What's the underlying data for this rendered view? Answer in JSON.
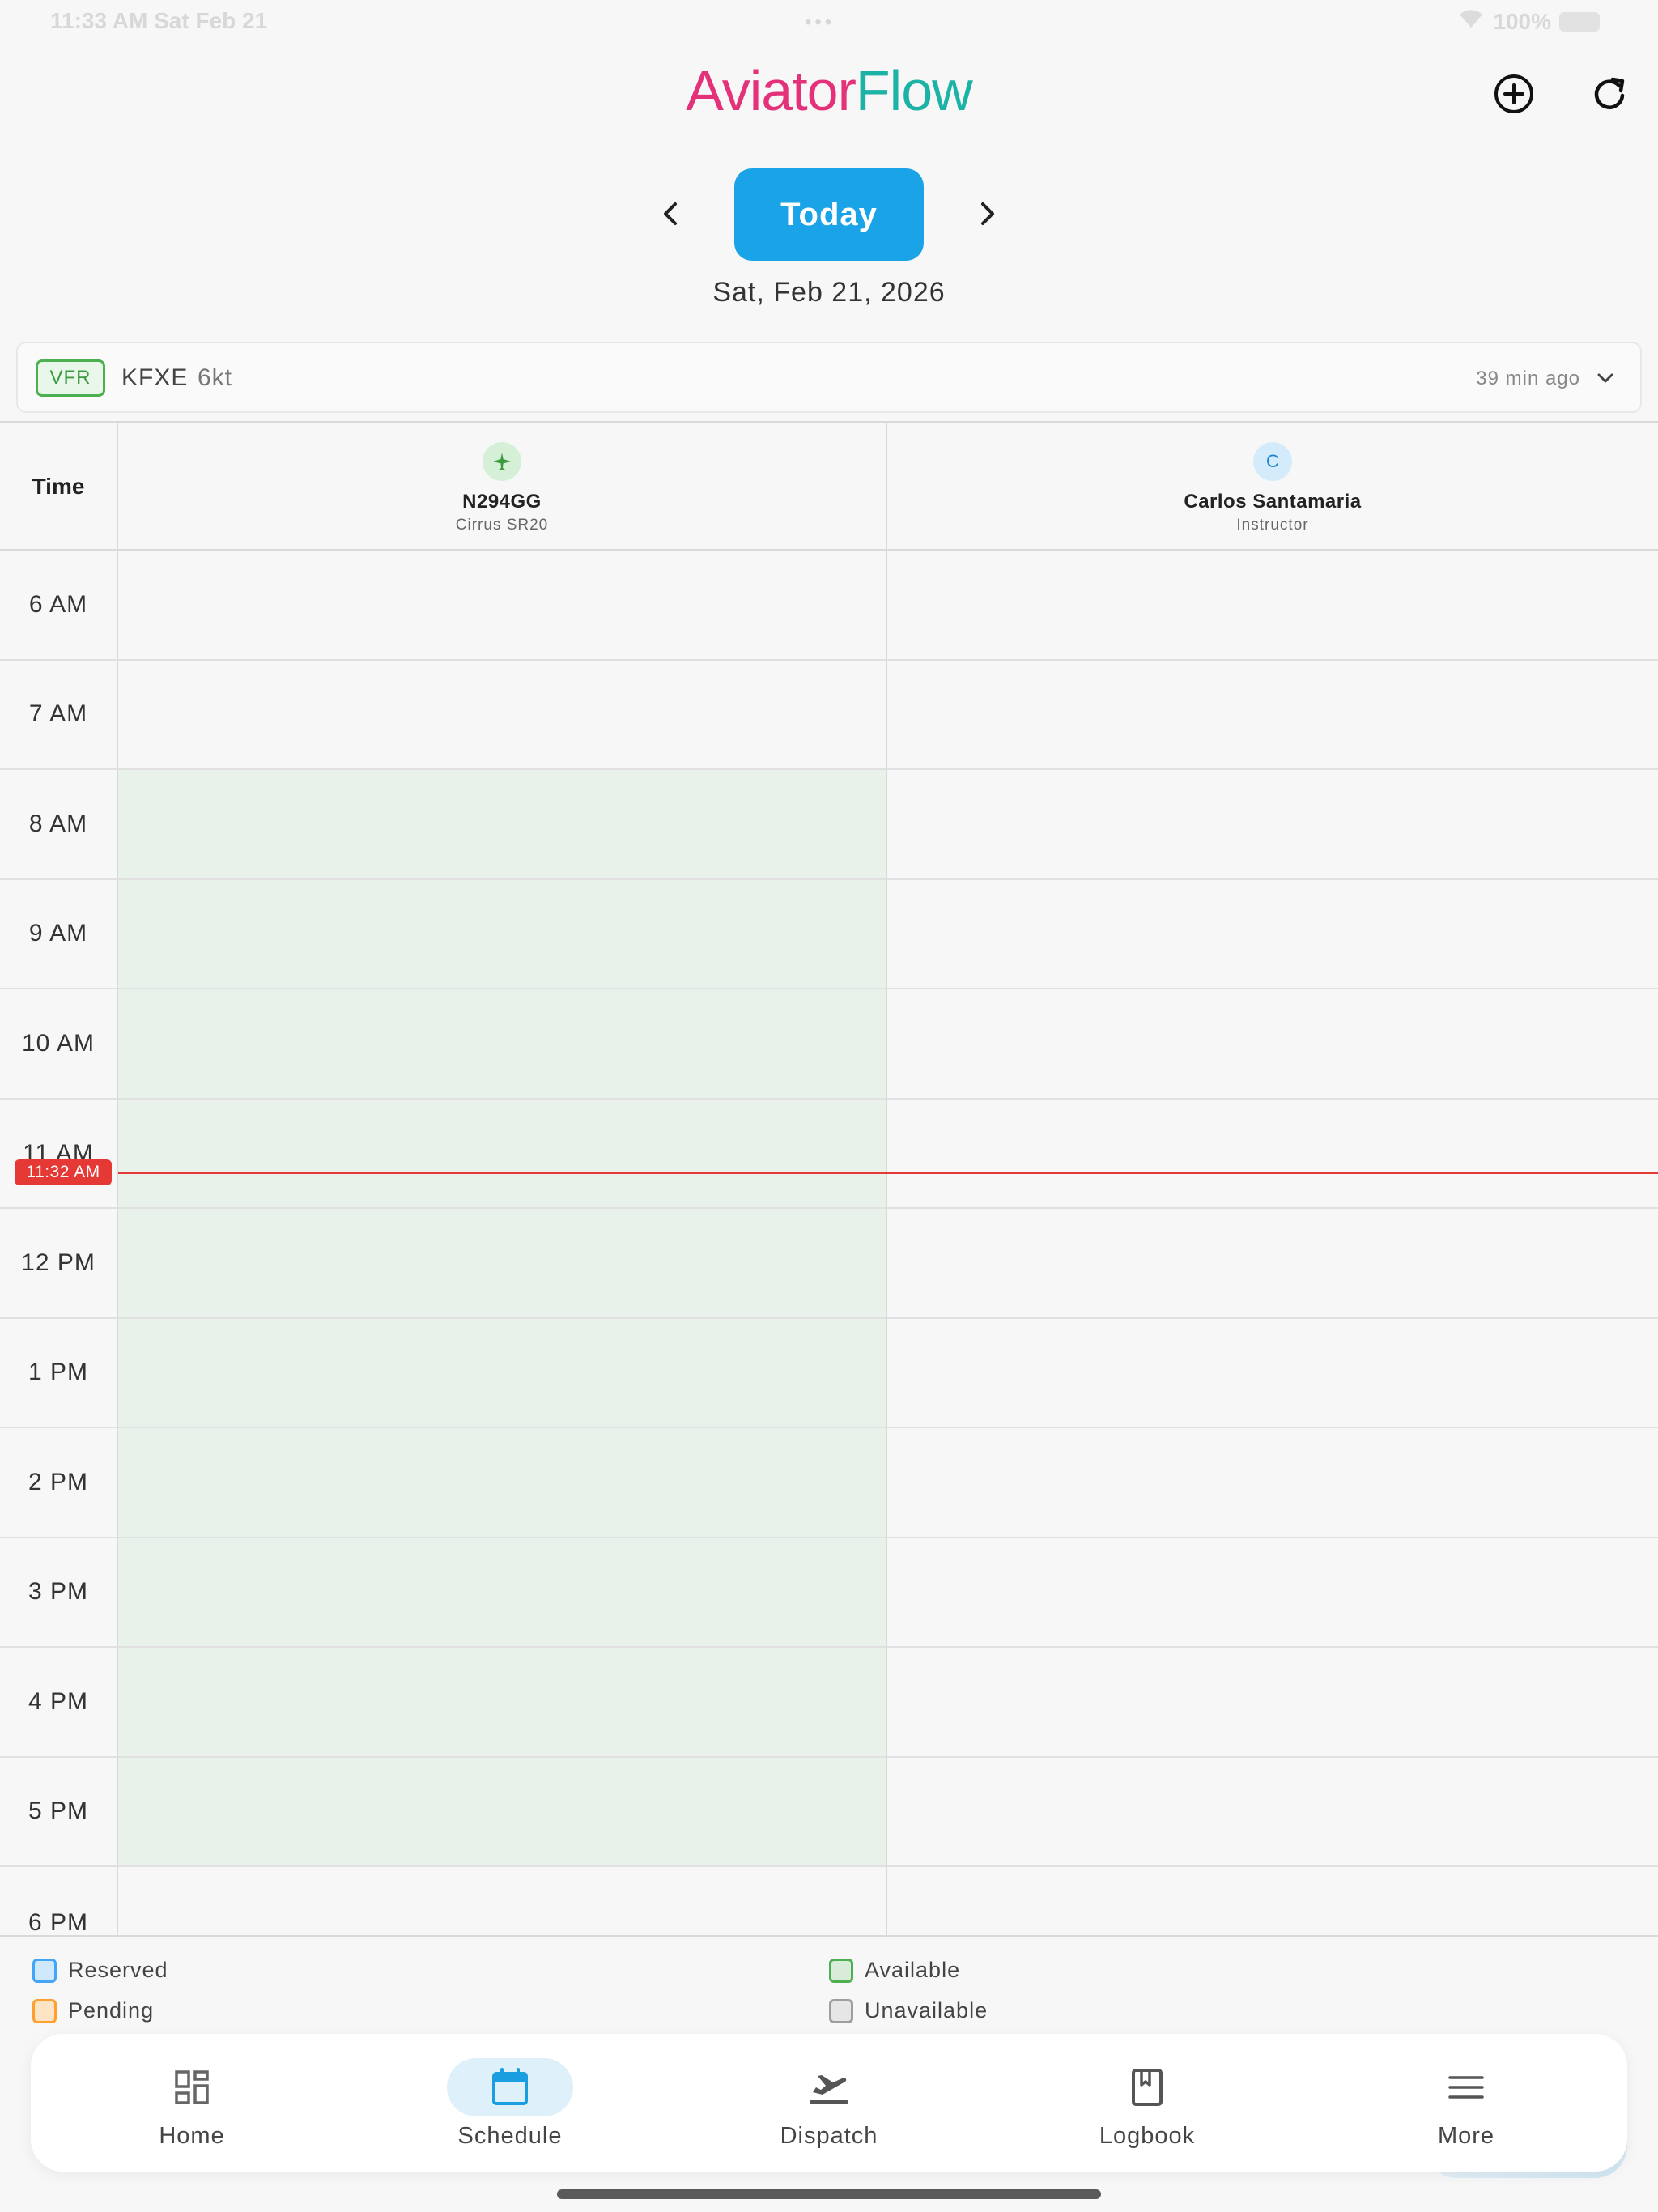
{
  "status": {
    "time": "11:33 AM   Sat Feb 21",
    "dots": "•••",
    "battery": "100%"
  },
  "brand": {
    "part1": "Aviator",
    "part2": "Flow"
  },
  "nav": {
    "today_label": "Today",
    "date": "Sat, Feb 21, 2026"
  },
  "weather": {
    "category": "VFR",
    "station": "KFXE",
    "wind": "6kt",
    "updated": "39 min ago"
  },
  "grid": {
    "time_header": "Time",
    "columns": [
      {
        "name": "N294GG",
        "sub": "Cirrus SR20",
        "icon": "airplane-icon"
      },
      {
        "name": "Carlos Santamaria",
        "sub": "Instructor",
        "avatar_letter": "C"
      }
    ],
    "hours": [
      "6 AM",
      "7 AM",
      "8 AM",
      "9 AM",
      "10 AM",
      "11 AM",
      "12 PM",
      "1 PM",
      "2 PM",
      "3 PM",
      "4 PM",
      "5 PM",
      "6 PM"
    ],
    "now_label": "11:32 AM"
  },
  "legend": {
    "reserved": "Reserved",
    "pending": "Pending",
    "available": "Available",
    "unavailable": "Unavailable"
  },
  "tabs": {
    "home": "Home",
    "schedule": "Schedule",
    "dispatch": "Dispatch",
    "logbook": "Logbook",
    "more": "More"
  },
  "colors": {
    "brand_pink": "#e33279",
    "brand_teal": "#1cb2a6",
    "accent": "#1aa3e6",
    "available": "#e8f2ea",
    "now": "#e53935",
    "vfr": "#4caf50"
  }
}
